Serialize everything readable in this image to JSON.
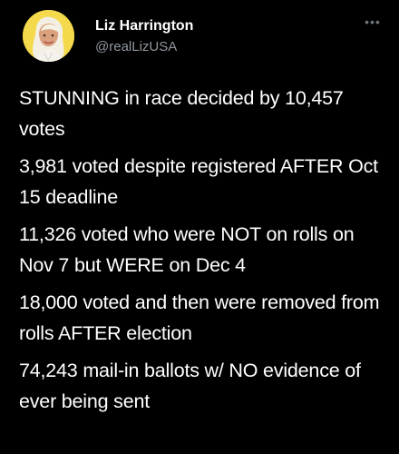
{
  "author": {
    "display_name": "Liz Harrington",
    "handle": "@realLizUSA",
    "avatar_icon": "profile-photo",
    "more_icon": "more-options-icon"
  },
  "tweet": {
    "paragraphs": [
      "STUNNING in race decided by 10,457 votes",
      "3,981 voted despite registered AFTER Oct 15 deadline",
      "11,326 voted who were NOT on rolls on Nov 7 but WERE on Dec 4",
      "18,000 voted and then were removed from rolls AFTER election",
      "74,243 mail-in ballots w/ NO evidence of ever being sent"
    ]
  },
  "colors": {
    "background": "#000000",
    "text_primary": "#ffffff",
    "text_secondary": "#8f969d",
    "avatar_background": "#f4d84b"
  }
}
